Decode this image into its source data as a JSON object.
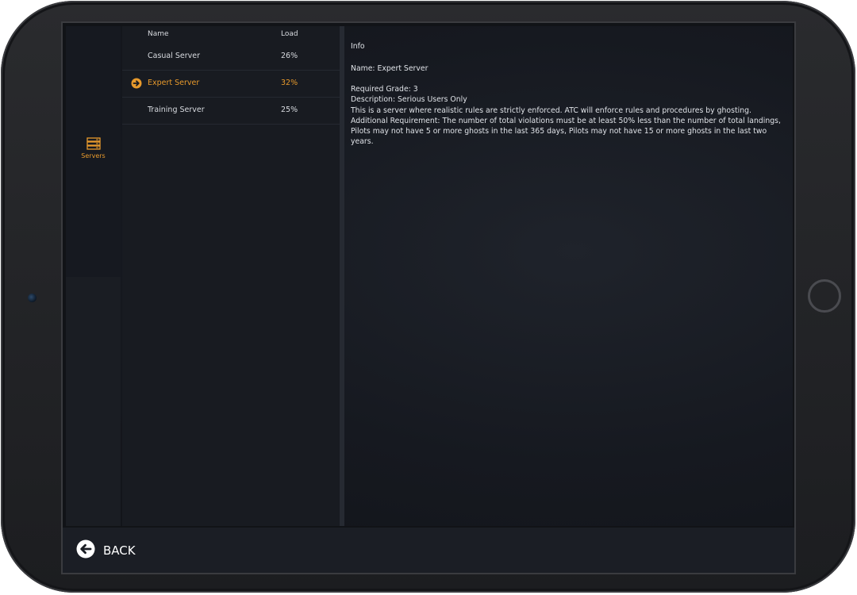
{
  "sidebar": {
    "items": [
      {
        "label": "Servers",
        "icon": "server-stack-icon",
        "active": true
      }
    ]
  },
  "server_list": {
    "columns": {
      "name": "Name",
      "load": "Load"
    },
    "rows": [
      {
        "name": "Casual Server",
        "load": "26%",
        "selected": false
      },
      {
        "name": "Expert Server",
        "load": "32%",
        "selected": true
      },
      {
        "name": "Training Server",
        "load": "25%",
        "selected": false
      }
    ]
  },
  "info": {
    "title": "Info",
    "name_line": "Name: Expert Server",
    "required_grade": "Required Grade: 3",
    "description": "Description: Serious Users Only",
    "details": "This is a server where realistic rules are strictly enforced. ATC will enforce rules and procedures by ghosting.",
    "additional_requirement": "Additional Requirement: The number of total violations must be at least 50% less than the number of total landings, Pilots may not have 5 or more ghosts in the last 365 days, Pilots may not have 15 or more ghosts in the last two years."
  },
  "footer": {
    "back_label": "BACK",
    "back_icon": "arrow-left-circle-icon"
  },
  "colors": {
    "accent": "#e89a2c",
    "background": "#161920",
    "text": "#e0e3e8"
  }
}
